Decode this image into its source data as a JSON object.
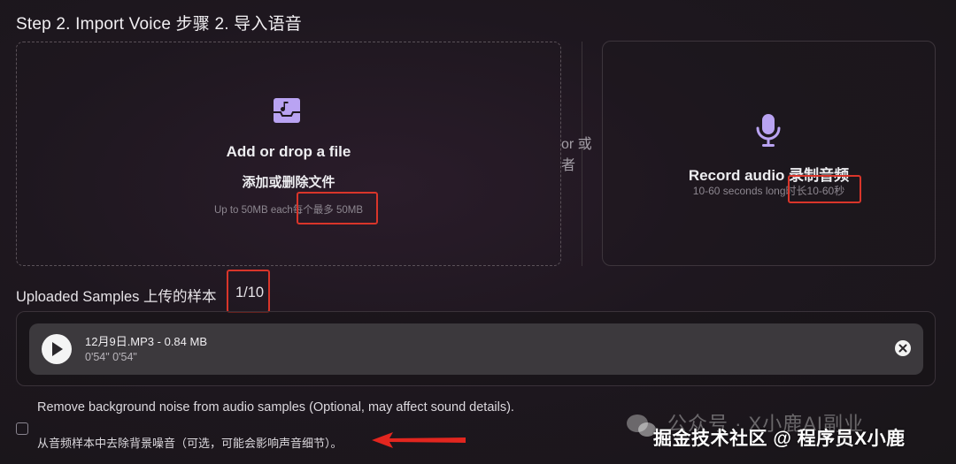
{
  "step_title": "Step 2. Import Voice 步骤 2. 导入语音",
  "dropzone": {
    "icon": "music-inbox-icon",
    "title": "Add or drop a file",
    "title_cn": "添加或删除文件",
    "limit_en": "Up to 50MB each",
    "limit_cn": "每个最多 50MB"
  },
  "separator": {
    "or_en": "or 或",
    "or_cn": "者"
  },
  "record": {
    "icon": "microphone-icon",
    "title": "Record audio 录制音频",
    "length_en": "10-60 seconds long",
    "length_cn": "时长10-60秒"
  },
  "uploaded": {
    "label": "Uploaded Samples 上传的样本",
    "count": "1/10",
    "samples": [
      {
        "name": "12月9日.MP3 - 0.84 MB",
        "duration": "0'54\" 0'54\""
      }
    ]
  },
  "noise_option": {
    "label_en": "Remove background noise from audio samples (Optional, may affect sound details).",
    "label_cn": "从音频样本中去除背景噪音（可选，可能会影响声音细节）。",
    "checked": false
  },
  "watermark": {
    "line1": "公众号 · X小鹿AI副业",
    "line2": "掘金技术社区 @ 程序员X小鹿"
  },
  "colors": {
    "accent": "#b9a3f2",
    "highlight": "#d9352a"
  }
}
